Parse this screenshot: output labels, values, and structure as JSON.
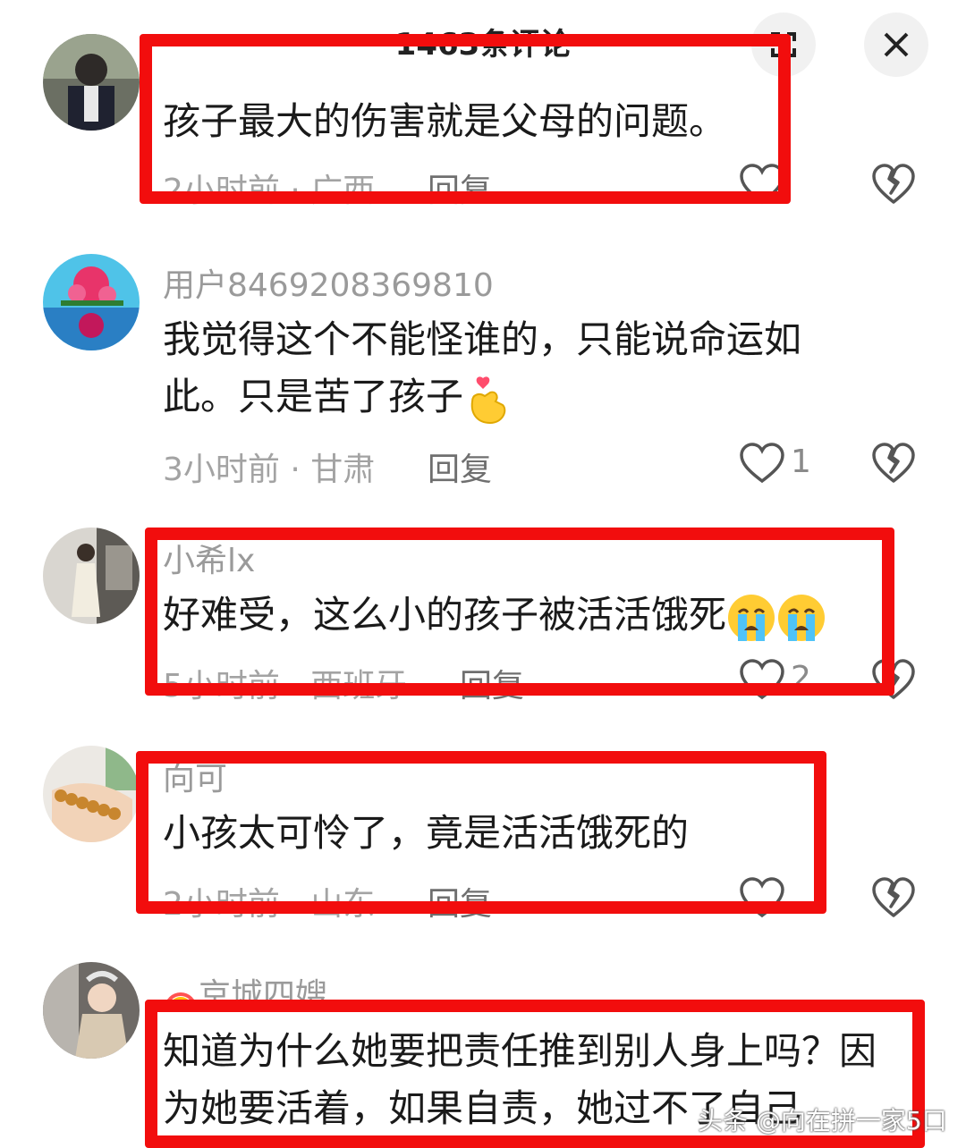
{
  "header": {
    "title": "1463条评论"
  },
  "comments": [
    {
      "username": "",
      "content": "孩子最大的伤害就是父母的问题。",
      "time_location": "2小时前 · 广西",
      "reply": "回复",
      "likes": ""
    },
    {
      "username": "用户8469208369810",
      "content": "我觉得这个不能怪谁的，只能说命运如此。只是苦了孩子",
      "time_location": "3小时前 · 甘肃",
      "reply": "回复",
      "likes": "1"
    },
    {
      "username": "小希lx",
      "content": "好难受，这么小的孩子被活活饿死",
      "time_location": "5小时前 · 西班牙",
      "reply": "回复",
      "likes": "2"
    },
    {
      "username": "向可",
      "content": "小孩太可怜了，竟是活活饿死的",
      "time_location": "2小时前 · 山东",
      "reply": "回复",
      "likes": ""
    },
    {
      "username": "京城四嫂",
      "content": "知道为什么她要把责任推到别人身上吗？因为她要活着，如果自责，她过不了自己",
      "time_location": "",
      "reply": "",
      "likes": ""
    }
  ],
  "watermark": "头条 @向在拼一家5口",
  "colors": {
    "highlight_box": "#f20d0d",
    "text_primary": "#1a1a1a",
    "text_secondary": "#a3a3a3"
  },
  "icons": [
    "expand-icon",
    "close-icon",
    "heart-outline-icon",
    "broken-heart-icon",
    "finger-heart-emoji",
    "crying-face-emoji",
    "rainbow-emoji"
  ]
}
